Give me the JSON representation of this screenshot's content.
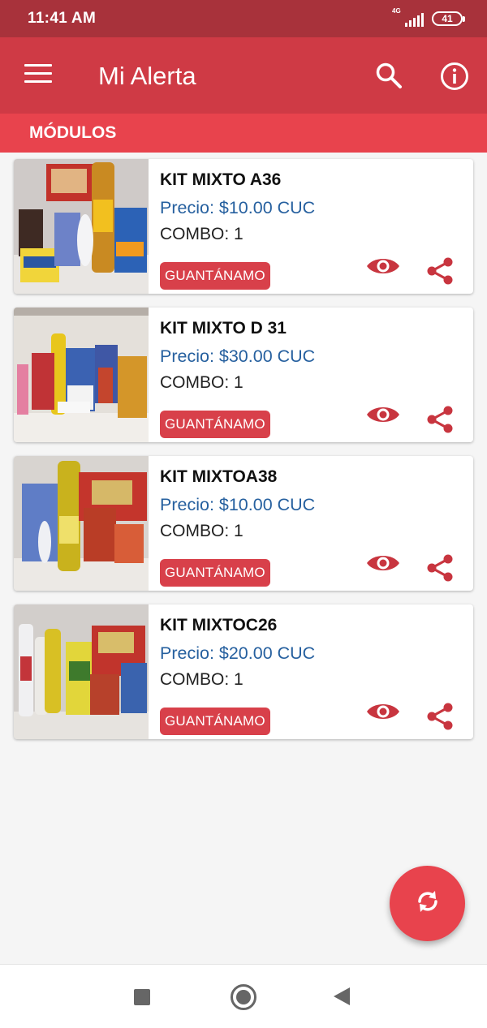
{
  "status_bar": {
    "time": "11:41 AM",
    "network": "4G",
    "battery": "41"
  },
  "app_bar": {
    "title": "Mi Alerta"
  },
  "section": {
    "title": "MÓDULOS"
  },
  "colors": {
    "primary": "#cf3a45",
    "status": "#a8323b",
    "accent": "#e8434d",
    "price": "#26609f"
  },
  "products": [
    {
      "title": "KIT MIXTO A36",
      "price": "Precio: $10.00 CUC",
      "combo": "COMBO: 1",
      "province": "GUANTÁNAMO"
    },
    {
      "title": "KIT MIXTO D 31",
      "price": "Precio: $30.00 CUC",
      "combo": "COMBO: 1",
      "province": "GUANTÁNAMO"
    },
    {
      "title": "KIT MIXTOA38",
      "price": "Precio: $10.00 CUC",
      "combo": "COMBO: 1",
      "province": "GUANTÁNAMO"
    },
    {
      "title": "KIT MIXTOC26",
      "price": "Precio: $20.00 CUC",
      "combo": "COMBO: 1",
      "province": "GUANTÁNAMO"
    }
  ],
  "icons": {
    "menu": "menu-icon",
    "search": "search-icon",
    "info": "info-icon",
    "view": "eye-icon",
    "share": "share-icon",
    "refresh": "refresh-icon"
  }
}
